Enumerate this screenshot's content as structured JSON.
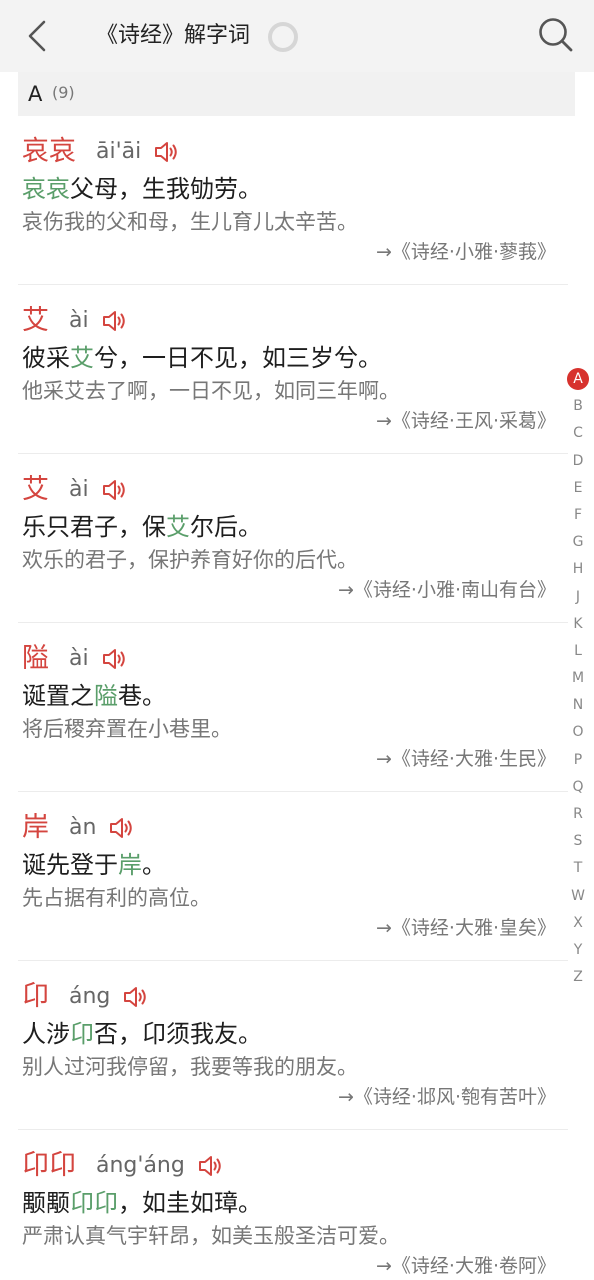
{
  "header": {
    "title": "《诗经》解字词"
  },
  "section": {
    "letter": "A",
    "count": "(9)"
  },
  "entries": [
    {
      "word": "哀哀",
      "pinyin": "āi'āi",
      "verse_pre": "",
      "verse_hl": "哀哀",
      "verse_post": "父母，生我劬劳。",
      "translation": "哀伤我的父和母，生儿育儿太辛苦。",
      "source": "→《诗经·小雅·蓼莪》"
    },
    {
      "word": "艾",
      "pinyin": "ài",
      "verse_pre": "彼采",
      "verse_hl": "艾",
      "verse_post": "兮，一日不见，如三岁兮。",
      "translation": "他采艾去了啊，一日不见，如同三年啊。",
      "source": "→《诗经·王风·采葛》"
    },
    {
      "word": "艾",
      "pinyin": "ài",
      "verse_pre": "乐只君子，保",
      "verse_hl": "艾",
      "verse_post": "尔后。",
      "translation": "欢乐的君子，保护养育好你的后代。",
      "source": "→《诗经·小雅·南山有台》"
    },
    {
      "word": "隘",
      "pinyin": "ài",
      "verse_pre": "诞置之",
      "verse_hl": "隘",
      "verse_post": "巷。",
      "translation": "将后稷弃置在小巷里。",
      "source": "→《诗经·大雅·生民》"
    },
    {
      "word": "岸",
      "pinyin": "àn",
      "verse_pre": "诞先登于",
      "verse_hl": "岸",
      "verse_post": "。",
      "translation": "先占据有利的高位。",
      "source": "→《诗经·大雅·皇矣》"
    },
    {
      "word": "卬",
      "pinyin": "áng",
      "verse_pre": "人涉",
      "verse_hl": "卬",
      "verse_post": "否，卬须我友。",
      "translation": "别人过河我停留，我要等我的朋友。",
      "source": "→《诗经·邶风·匏有苦叶》"
    },
    {
      "word": "卬卬",
      "pinyin": "áng'áng",
      "verse_pre": "颙颙",
      "verse_hl": "卬卬",
      "verse_post": "，如圭如璋。",
      "translation": "严肃认真气宇轩昂，如美玉般圣洁可爱。",
      "source": "→《诗经·大雅·卷阿》"
    }
  ],
  "index_letters": [
    "A",
    "B",
    "C",
    "D",
    "E",
    "F",
    "G",
    "H",
    "J",
    "K",
    "L",
    "M",
    "N",
    "O",
    "P",
    "Q",
    "R",
    "S",
    "T",
    "W",
    "X",
    "Y",
    "Z"
  ],
  "active_letter": "A",
  "colors": {
    "accent_red": "#d4453f",
    "highlight_green": "#5a9e6a",
    "index_active": "#d7322d"
  },
  "icons": {
    "back": "chevron-left-icon",
    "search": "search-icon",
    "speaker": "speaker-icon",
    "loading": "loading-ring-icon"
  }
}
